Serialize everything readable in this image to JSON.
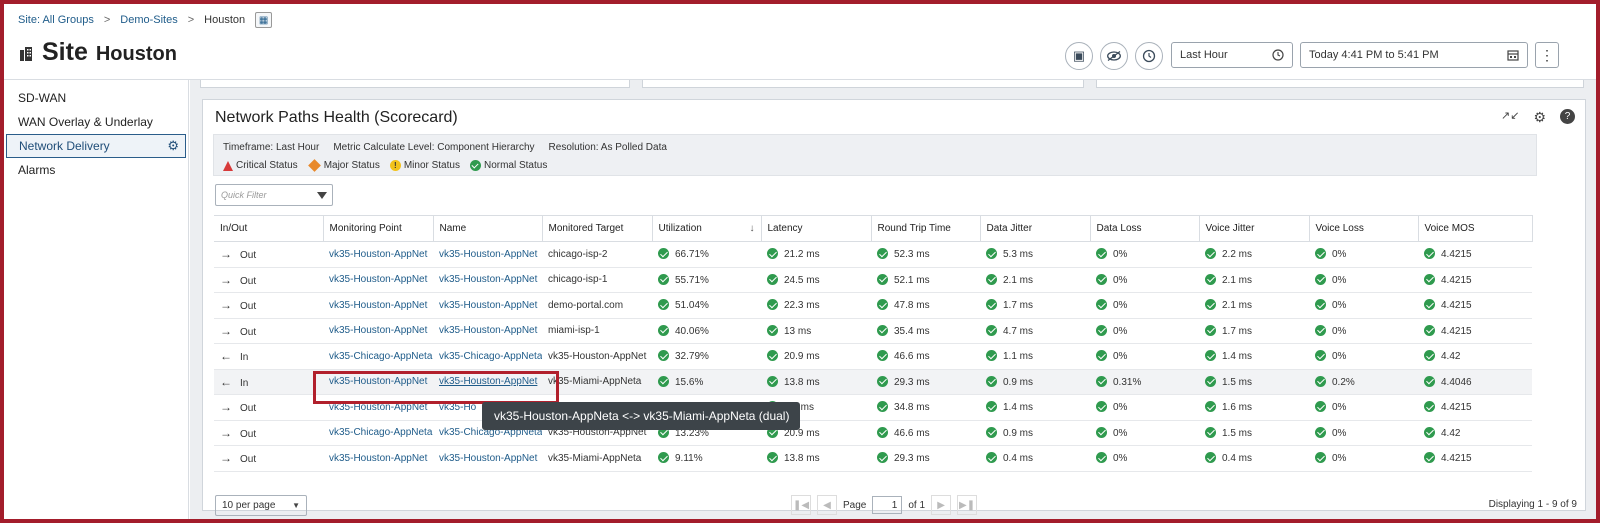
{
  "breadcrumb": {
    "items": [
      "Site: All Groups",
      "Demo-Sites",
      "Houston"
    ]
  },
  "title": {
    "main": "Site",
    "sub": "Houston"
  },
  "header": {
    "time_select": "Last Hour",
    "time_range": "Today 4:41 PM to 5:41 PM"
  },
  "sidebar": {
    "items": [
      {
        "label": "SD-WAN"
      },
      {
        "label": "WAN Overlay & Underlay"
      },
      {
        "label": "Network Delivery"
      },
      {
        "label": "Alarms"
      }
    ]
  },
  "panel": {
    "title": "Network Paths Health (Scorecard)",
    "timeframe": "Timeframe: Last Hour",
    "metric_level": "Metric Calculate Level: Component Hierarchy",
    "resolution": "Resolution: As Polled Data",
    "legend": {
      "critical": "Critical Status",
      "major": "Major Status",
      "minor": "Minor Status",
      "normal": "Normal Status"
    },
    "quick_filter_placeholder": "Quick Filter"
  },
  "table": {
    "columns": [
      "In/Out",
      "Monitoring Point",
      "Name",
      "Monitored Target",
      "Utilization",
      "Latency",
      "Round Trip Time",
      "Data Jitter",
      "Data Loss",
      "Voice Jitter",
      "Voice Loss",
      "Voice MOS"
    ],
    "rows": [
      {
        "dir": "Out",
        "arrow": "→",
        "mp": "vk35-Houston-AppNet",
        "name": "vk35-Houston-AppNet",
        "target": "chicago-isp-2",
        "util": "66.71%",
        "lat": "21.2 ms",
        "rtt": "52.3 ms",
        "djit": "5.3 ms",
        "dloss": "0%",
        "vjit": "2.2 ms",
        "vloss": "0%",
        "mos": "4.4215"
      },
      {
        "dir": "Out",
        "arrow": "→",
        "mp": "vk35-Houston-AppNet",
        "name": "vk35-Houston-AppNet",
        "target": "chicago-isp-1",
        "util": "55.71%",
        "lat": "24.5 ms",
        "rtt": "52.1 ms",
        "djit": "2.1 ms",
        "dloss": "0%",
        "vjit": "2.1 ms",
        "vloss": "0%",
        "mos": "4.4215"
      },
      {
        "dir": "Out",
        "arrow": "→",
        "mp": "vk35-Houston-AppNet",
        "name": "vk35-Houston-AppNet",
        "target": "demo-portal.com",
        "util": "51.04%",
        "lat": "22.3 ms",
        "rtt": "47.8 ms",
        "djit": "1.7 ms",
        "dloss": "0%",
        "vjit": "2.1 ms",
        "vloss": "0%",
        "mos": "4.4215"
      },
      {
        "dir": "Out",
        "arrow": "→",
        "mp": "vk35-Houston-AppNet",
        "name": "vk35-Houston-AppNet",
        "target": "miami-isp-1",
        "util": "40.06%",
        "lat": "13 ms",
        "rtt": "35.4 ms",
        "djit": "4.7 ms",
        "dloss": "0%",
        "vjit": "1.7 ms",
        "vloss": "0%",
        "mos": "4.4215"
      },
      {
        "dir": "In",
        "arrow": "←",
        "mp": "vk35-Chicago-AppNeta",
        "name": "vk35-Chicago-AppNeta",
        "target": "vk35-Houston-AppNet",
        "util": "32.79%",
        "lat": "20.9 ms",
        "rtt": "46.6 ms",
        "djit": "1.1 ms",
        "dloss": "0%",
        "vjit": "1.4 ms",
        "vloss": "0%",
        "mos": "4.42"
      },
      {
        "dir": "In",
        "arrow": "←",
        "mp": "vk35-Houston-AppNet",
        "name": "vk35-Houston-AppNet",
        "target": "vk35-Miami-AppNeta",
        "util": "15.6%",
        "lat": "13.8 ms",
        "rtt": "29.3 ms",
        "djit": "0.9 ms",
        "dloss": "0.31%",
        "vjit": "1.5 ms",
        "vloss": "0.2%",
        "mos": "4.4046"
      },
      {
        "dir": "Out",
        "arrow": "→",
        "mp": "vk35-Houston-AppNet",
        "name": "vk35-Ho",
        "target": "",
        "util": "",
        "lat": "6.5 ms",
        "rtt": "34.8 ms",
        "djit": "1.4 ms",
        "dloss": "0%",
        "vjit": "1.6 ms",
        "vloss": "0%",
        "mos": "4.4215"
      },
      {
        "dir": "Out",
        "arrow": "→",
        "mp": "vk35-Chicago-AppNeta",
        "name": "vk35-Chicago-AppNeta",
        "target": "vk35-Houston-AppNet",
        "util": "13.23%",
        "lat": "20.9 ms",
        "rtt": "46.6 ms",
        "djit": "0.9 ms",
        "dloss": "0%",
        "vjit": "1.5 ms",
        "vloss": "0%",
        "mos": "4.42"
      },
      {
        "dir": "Out",
        "arrow": "→",
        "mp": "vk35-Houston-AppNet",
        "name": "vk35-Houston-AppNet",
        "target": "vk35-Miami-AppNeta",
        "util": "9.11%",
        "lat": "13.8 ms",
        "rtt": "29.3 ms",
        "djit": "0.4 ms",
        "dloss": "0%",
        "vjit": "0.4 ms",
        "vloss": "0%",
        "mos": "4.4215"
      }
    ]
  },
  "tooltip": "vk35-Houston-AppNeta <-> vk35-Miami-AppNeta (dual)",
  "pager": {
    "per_page": "10 per page",
    "page_label": "Page",
    "page_value": "1",
    "of_label": "of 1",
    "displaying": "Displaying 1 - 9 of 9"
  },
  "colors": {
    "accent": "#1f5c8a",
    "normal": "#2f9a4e",
    "critical": "#d73a3a",
    "major": "#e8892b",
    "minor": "#f2c21b",
    "frame": "#a31d2b"
  },
  "icons": [
    "site-hierarchy-icon",
    "building-icon",
    "eye-icon",
    "history-icon",
    "clock-icon",
    "calendar-icon",
    "kebab-menu-icon",
    "gear-icon",
    "collapse-icon",
    "help-icon",
    "filter-icon",
    "sort-down-icon"
  ]
}
